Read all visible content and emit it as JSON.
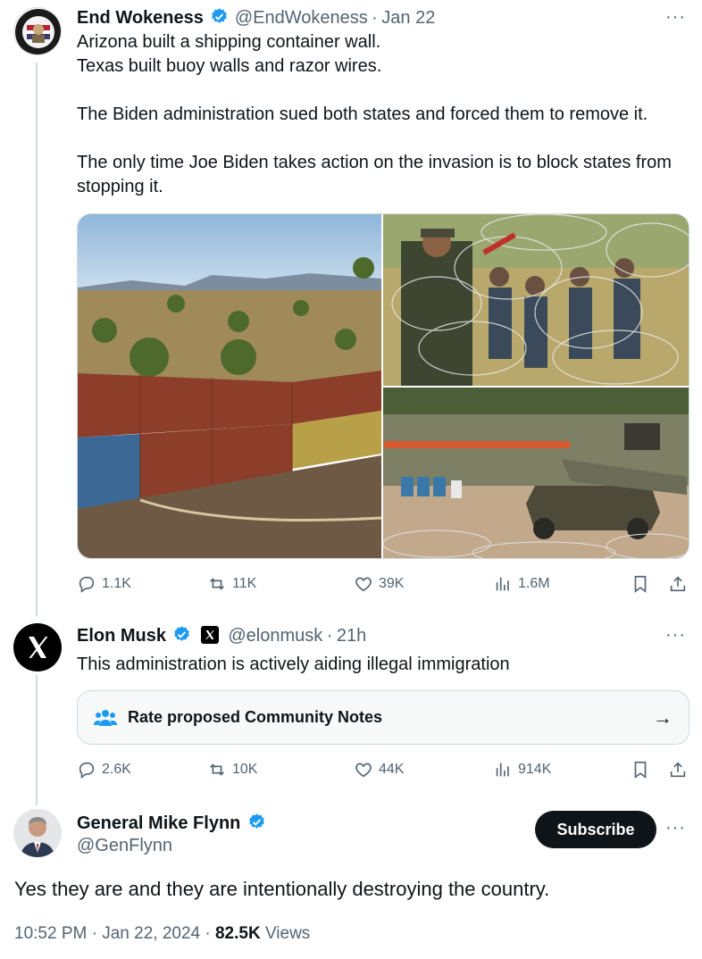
{
  "tweet1": {
    "name": "End Wokeness",
    "handle": "@EndWokeness",
    "separator": "·",
    "time": "Jan 22",
    "more": "···",
    "text": "Arizona built a shipping container wall.\nTexas built buoy walls and razor wires.\n\nThe Biden administration sued both states and forced them to remove it.\n\nThe only time Joe Biden takes action on the invasion is to block states from stopping it.",
    "avatar_text": "SUPPORT OUR BORDER TROOPS",
    "images": [
      "shipping-container-wall-photo",
      "razor-wire-photo",
      "buoy-wall-river-photo"
    ],
    "actions": {
      "replies": "1.1K",
      "reposts": "11K",
      "likes": "39K",
      "views": "1.6M"
    }
  },
  "tweet2": {
    "name": "Elon Musk",
    "handle": "@elonmusk",
    "separator": "·",
    "time": "21h",
    "more": "···",
    "text": "This administration is actively aiding illegal immigration",
    "community_notes_label": "Rate proposed Community Notes",
    "community_notes_arrow": "→",
    "actions": {
      "replies": "2.6K",
      "reposts": "10K",
      "likes": "44K",
      "views": "914K"
    }
  },
  "tweet3": {
    "name": "General Mike Flynn",
    "handle": "@GenFlynn",
    "subscribe_label": "Subscribe",
    "more": "···",
    "text": "Yes they are and they are intentionally destroying the country.",
    "time": "10:52 PM",
    "date": "Jan 22, 2024",
    "dot": "·",
    "views_count": "82.5K",
    "views_label": "Views"
  },
  "colors": {
    "verified": "#1d9bf0",
    "text": "#0f1419",
    "muted": "#536471",
    "border": "#cfd9de"
  }
}
